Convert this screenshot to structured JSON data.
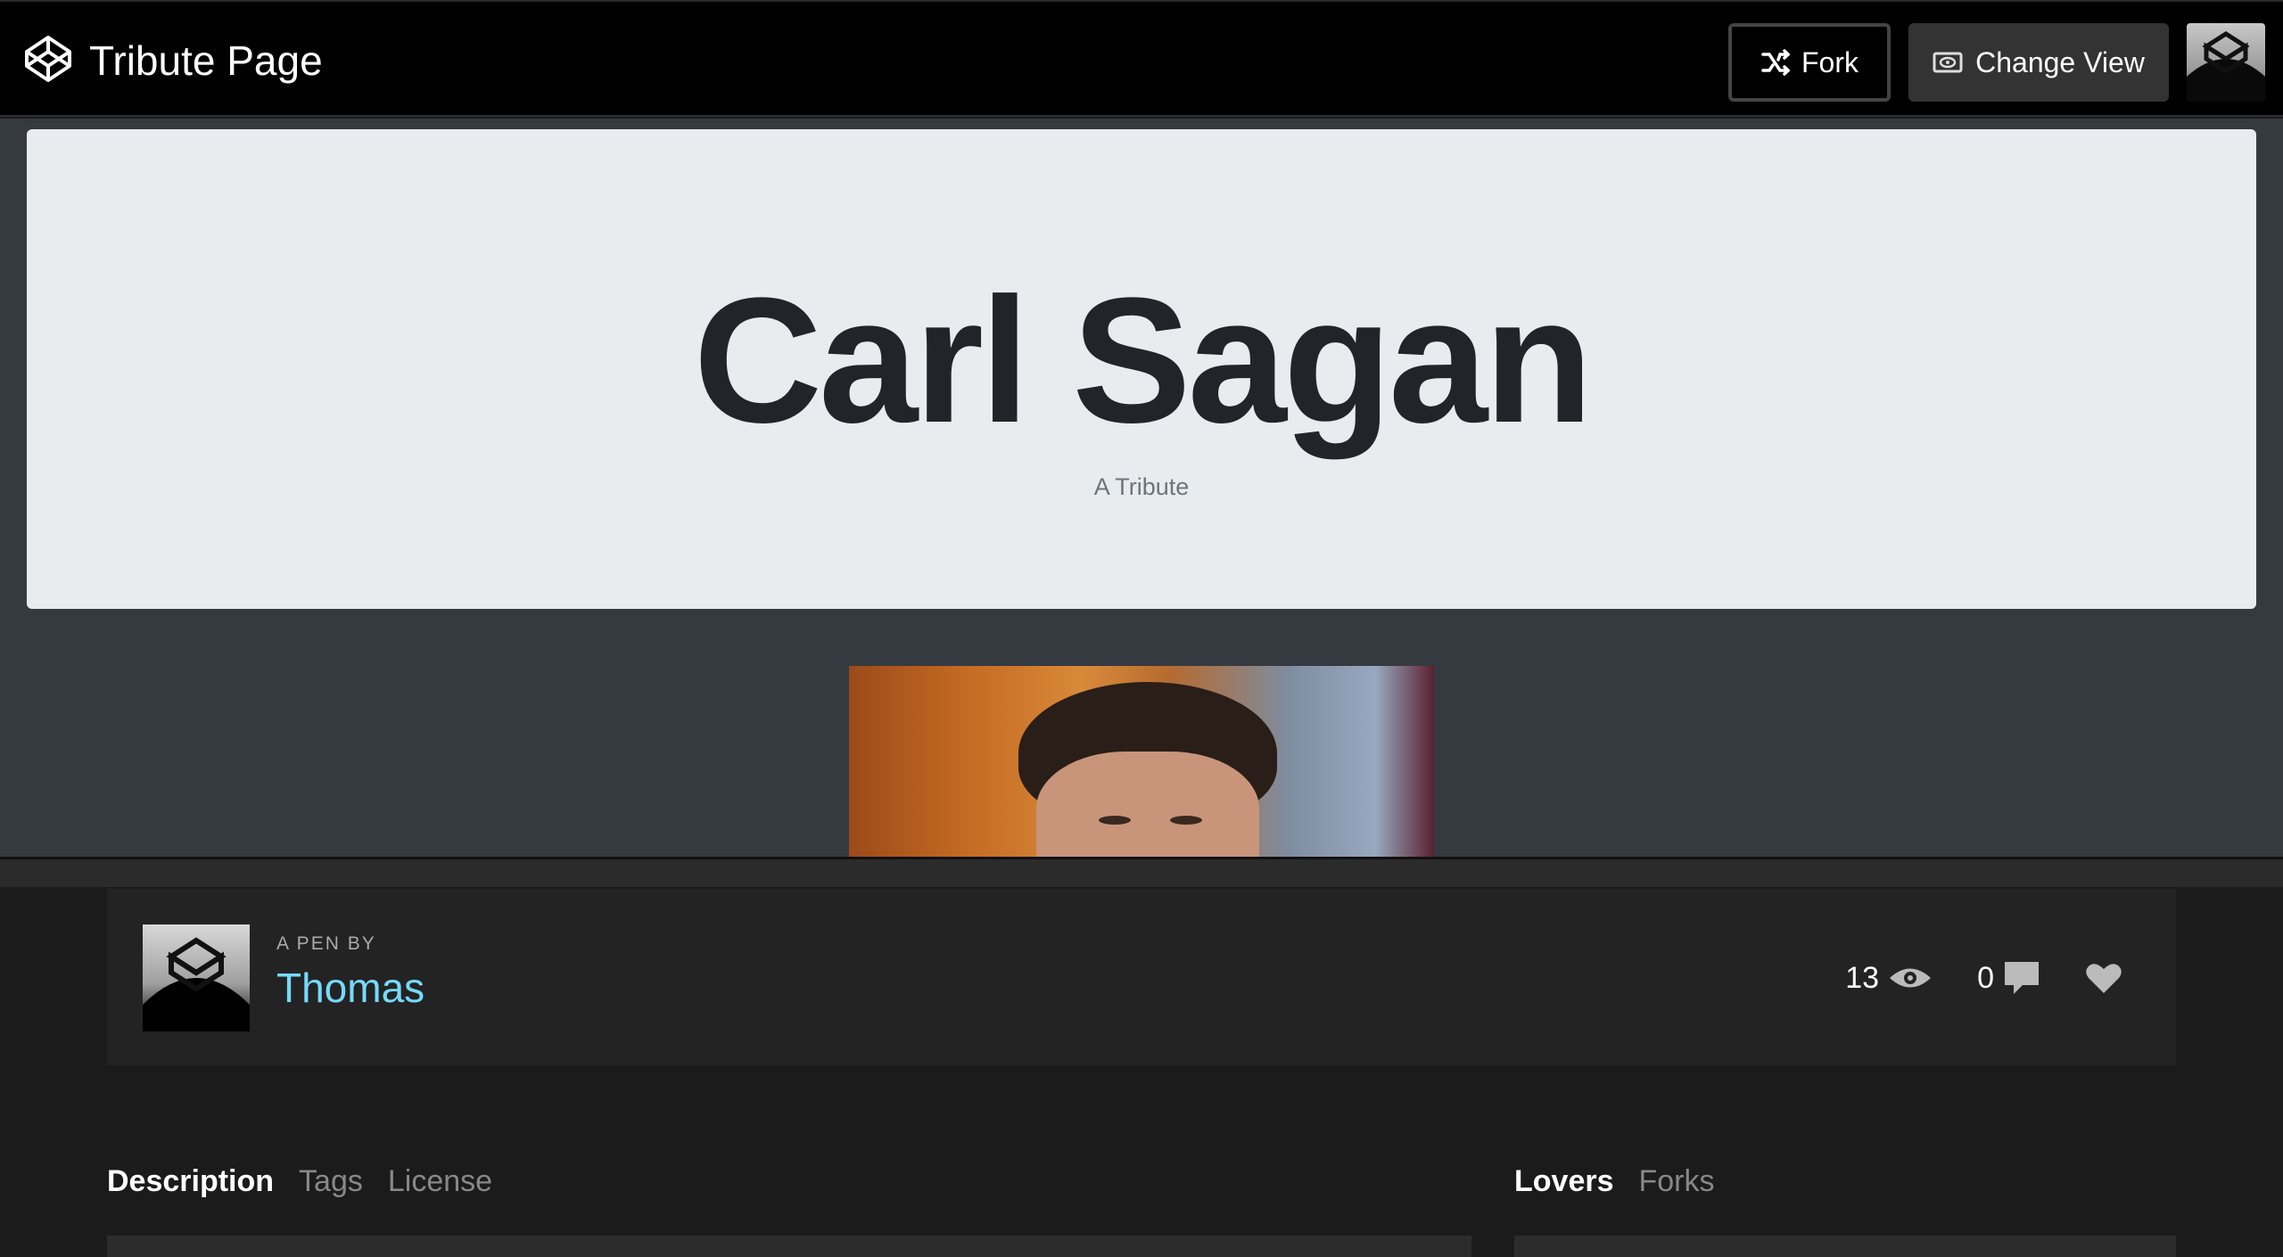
{
  "header": {
    "title": "Tribute Page",
    "fork_label": "Fork",
    "change_view_label": "Change View",
    "logo_icon": "codepen-logo-icon"
  },
  "preview": {
    "heading": "Carl Sagan",
    "subheading": "A Tribute",
    "jumbotron_bg": "#e9ecef",
    "preview_bg": "#353a40"
  },
  "pen_info": {
    "pen_by": "A PEN BY",
    "author": "Thomas",
    "views": "13",
    "comments": "0",
    "author_color": "#76daff"
  },
  "tabs_left": [
    {
      "label": "Description",
      "active": true
    },
    {
      "label": "Tags",
      "active": false
    },
    {
      "label": "License",
      "active": false
    }
  ],
  "tabs_right": [
    {
      "label": "Lovers",
      "active": true
    },
    {
      "label": "Forks",
      "active": false
    }
  ]
}
